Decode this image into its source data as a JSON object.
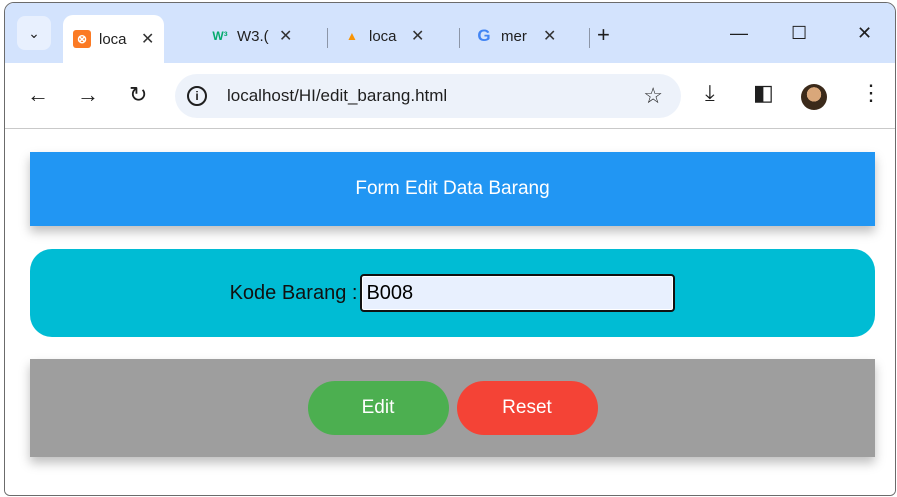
{
  "browser": {
    "tabs": [
      {
        "title": "loca",
        "icon": "xampp-icon",
        "active": true
      },
      {
        "title": "W3.(",
        "icon": "w3schools-icon",
        "active": false
      },
      {
        "title": "loca",
        "icon": "phpmyadmin-icon",
        "active": false
      },
      {
        "title": "mer",
        "icon": "google-icon",
        "active": false
      }
    ],
    "new_tab": "+",
    "url": "localhost/HI/edit_barang.html"
  },
  "page": {
    "header_title": "Form Edit Data Barang",
    "kode_label": "Kode Barang :",
    "kode_value": "B008",
    "edit_label": "Edit",
    "reset_label": "Reset"
  },
  "colors": {
    "header_bg": "#2196f3",
    "input_panel_bg": "#00bcd4",
    "button_panel_bg": "#9e9e9e",
    "edit_bg": "#4caf50",
    "reset_bg": "#f44336"
  }
}
